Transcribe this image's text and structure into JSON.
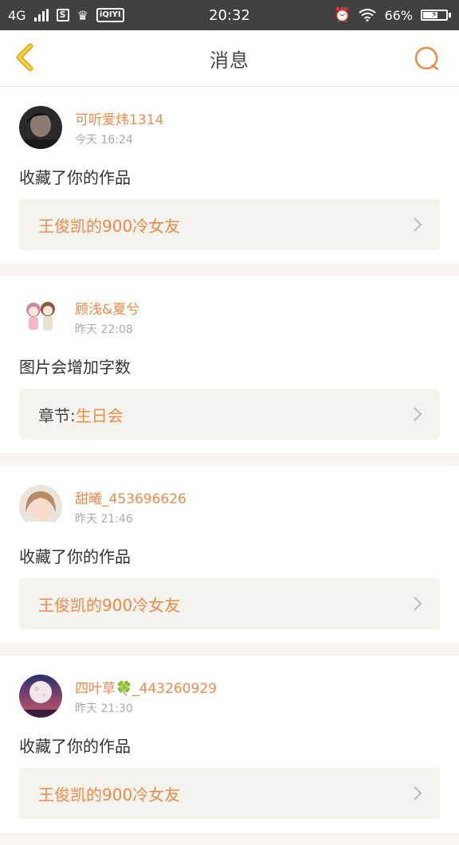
{
  "status_bar": {
    "network": "4G",
    "time": "20:32",
    "battery_percent": "66%",
    "battery_level": 0.66,
    "app_icons": [
      "s-icon",
      "crown-icon",
      "iqiyi-icon"
    ],
    "iqiyi_label": "iQIYI"
  },
  "header": {
    "title": "消息"
  },
  "colors": {
    "accent": "#f08a4b",
    "back_arrow": "#f5c23a",
    "status_bar_bg": "#414141",
    "ref_bg": "#f4f3ed"
  },
  "messages": [
    {
      "username": "可听爱炜1314",
      "time": "今天 16:24",
      "action": "收藏了你的作品",
      "ref_prefix": "",
      "ref_title": "王俊凯的900冷女友",
      "avatar": "dark-portrait"
    },
    {
      "username": "顾浅&夏兮",
      "time": "昨天 22:08",
      "action": "图片会增加字数",
      "ref_prefix": "章节:",
      "ref_title": "生日会",
      "avatar": "cartoon-couple"
    },
    {
      "username": "甜曦_453696626",
      "time": "昨天 21:46",
      "action": "收藏了你的作品",
      "ref_prefix": "",
      "ref_title": "王俊凯的900冷女友",
      "avatar": "girl-portrait"
    },
    {
      "username": "四叶草🍀_443260929",
      "time": "昨天 21:30",
      "action": "收藏了你的作品",
      "ref_prefix": "",
      "ref_title": "王俊凯的900冷女友",
      "avatar": "moon-night"
    }
  ]
}
